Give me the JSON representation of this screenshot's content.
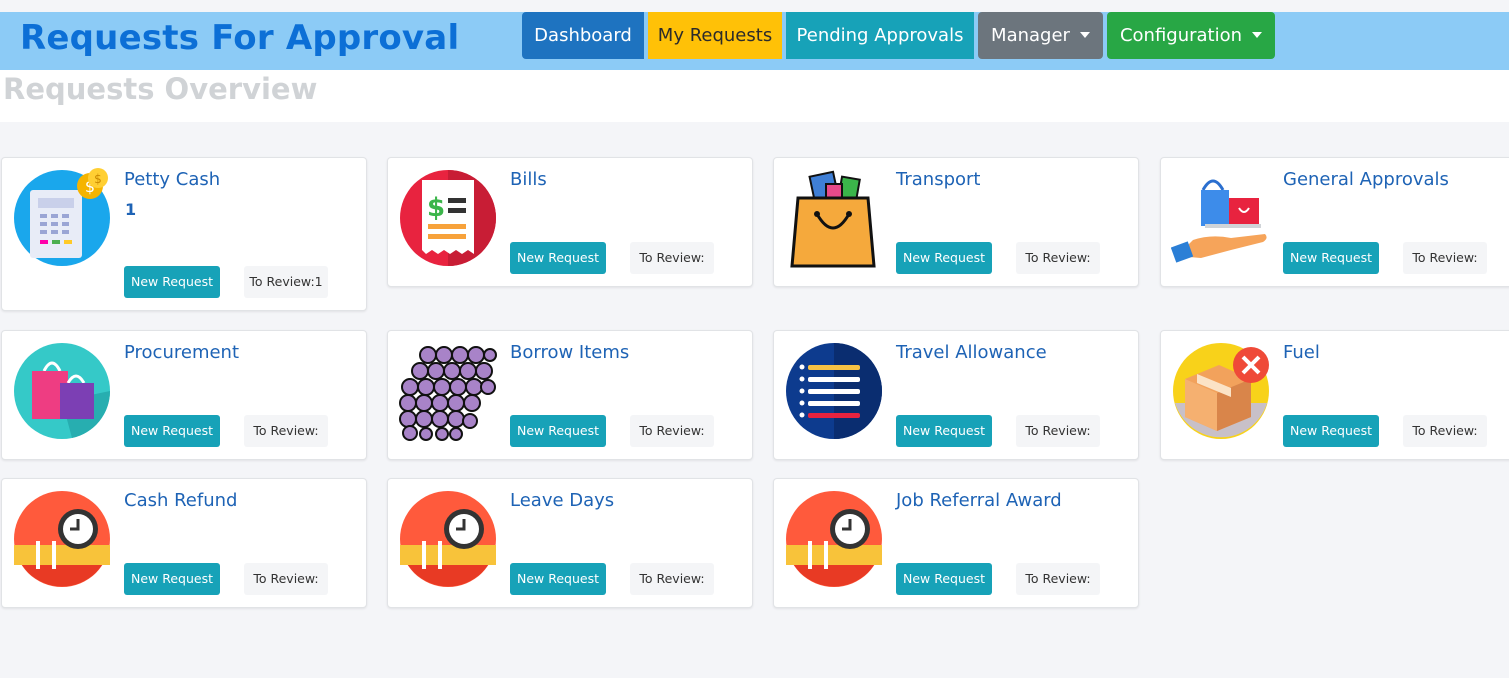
{
  "header": {
    "brand": "Requests For Approval",
    "nav": {
      "dashboard": "Dashboard",
      "my_requests": "My Requests",
      "pending": "Pending Approvals",
      "manager": "Manager",
      "configuration": "Configuration"
    }
  },
  "page_title": "Requests Overview",
  "new_request_label": "New Request",
  "cards": [
    {
      "name": "Petty Cash",
      "count": "1",
      "review": "To Review:1",
      "icon": "receipt-coins-icon"
    },
    {
      "name": "Bills",
      "review": "To Review:",
      "icon": "bill-icon"
    },
    {
      "name": "Transport",
      "review": "To Review:",
      "icon": "shopping-bag-icon"
    },
    {
      "name": "General Approvals",
      "review": "To Review:",
      "icon": "hand-bag-icon"
    },
    {
      "name": "Procurement",
      "review": "To Review:",
      "icon": "shopping-bags-icon"
    },
    {
      "name": "Borrow Items",
      "review": "To Review:",
      "icon": "spheres-icon"
    },
    {
      "name": "Travel Allowance",
      "review": "To Review:",
      "icon": "list-icon"
    },
    {
      "name": "Fuel",
      "review": "To Review:",
      "icon": "box-cancel-icon"
    },
    {
      "name": "Cash Refund",
      "review": "To Review:",
      "icon": "clock-icon"
    },
    {
      "name": "Leave Days",
      "review": "To Review:",
      "icon": "clock-icon"
    },
    {
      "name": "Job Referral Award",
      "review": "To Review:",
      "icon": "clock-icon"
    }
  ]
}
